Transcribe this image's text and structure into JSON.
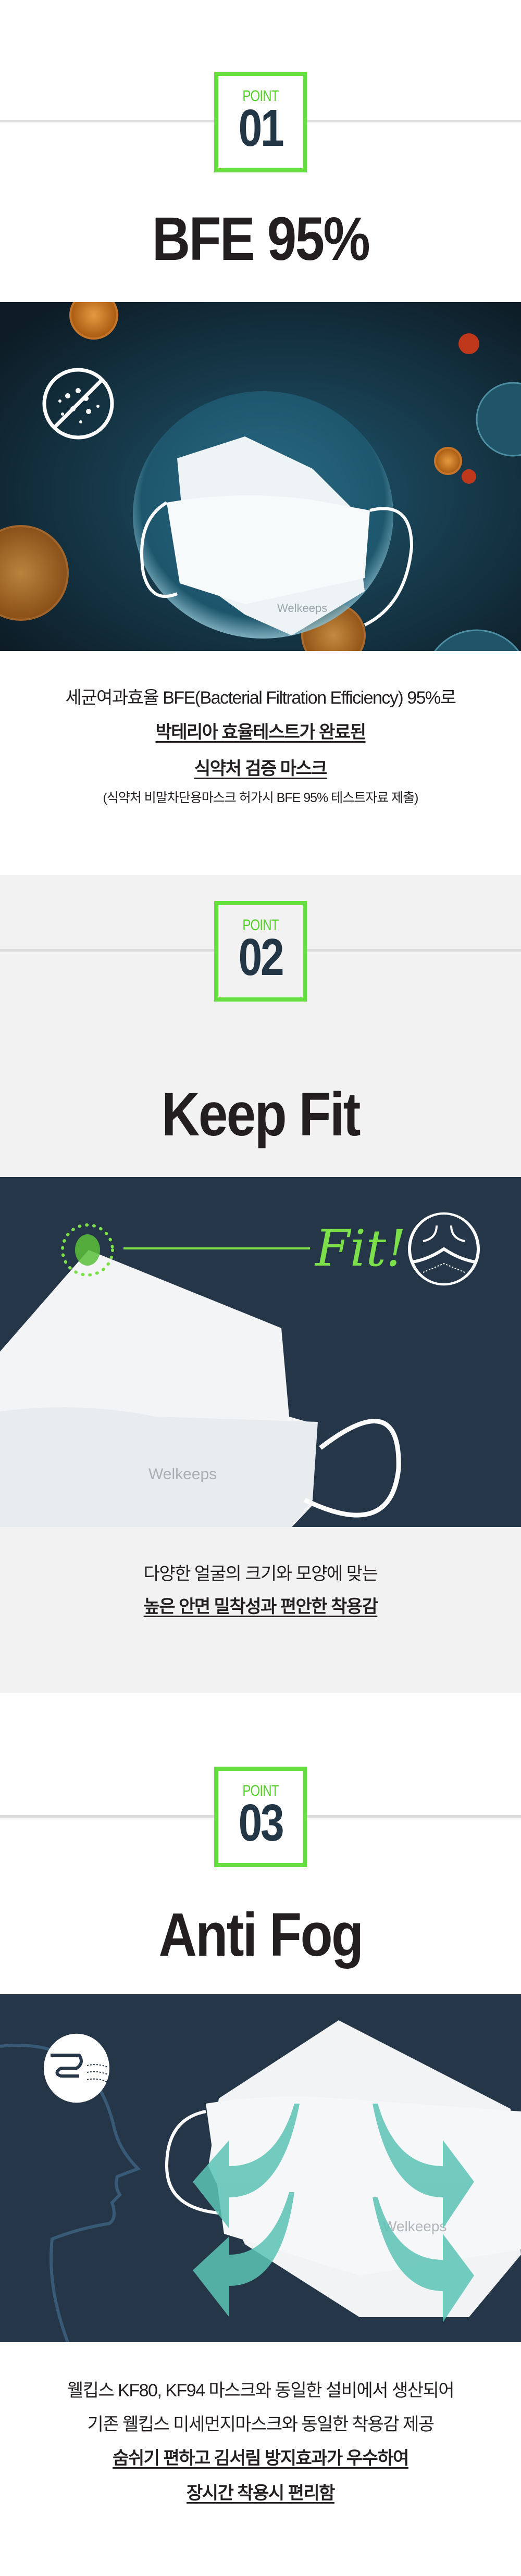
{
  "colors": {
    "accent": "#68df40",
    "point_number": "#233646",
    "image_bg": "#243647",
    "gray_bg": "#f2f2f2",
    "arrow": "#5cc3b5"
  },
  "points": [
    {
      "label": "POINT",
      "number": "01",
      "title": "BFE 95%",
      "image": {
        "brand": "Welkeeps",
        "icon": "no-bacteria-icon"
      },
      "lines": [
        "세균여과효율 BFE(Bacterial Filtration Efficiency) 95%로"
      ],
      "highlights": [
        "박테리아 효율테스트가 완료된",
        "식약처 검증 마스크"
      ],
      "note": "(식약처 비말차단용마스크 허가시 BFE 95% 테스트자료 제출)"
    },
    {
      "label": "POINT",
      "number": "02",
      "title": "Keep Fit",
      "image": {
        "brand": "Welkeeps",
        "fit_text": "Fit!",
        "icon": "mask-fit-icon"
      },
      "lines": [
        "다양한 얼굴의 크기와 모양에 맞는"
      ],
      "highlights": [
        "높은 안면 밀착성과 편안한 착용감"
      ]
    },
    {
      "label": "POINT",
      "number": "03",
      "title": "Anti Fog",
      "image": {
        "brand": "Welkeeps",
        "icon": "breathing-face-icon"
      },
      "lines": [
        "웰킵스 KF80, KF94 마스크와 동일한 설비에서 생산되어",
        "기존 웰킵스 미세먼지마스크와 동일한 착용감 제공"
      ],
      "highlights": [
        "숨쉬기 편하고 김서림 방지효과가 우수하여",
        "장시간 착용시 편리함"
      ]
    }
  ]
}
